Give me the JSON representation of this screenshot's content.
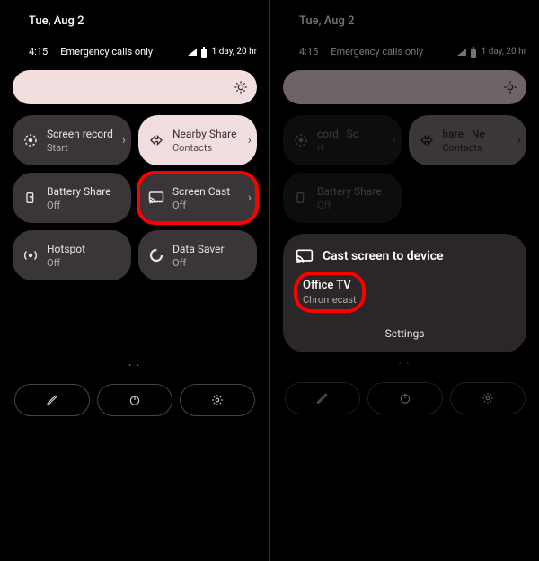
{
  "date": "Tue, Aug 2",
  "status": {
    "time": "4:15",
    "emergency": "Emergency calls only",
    "battery": "1 day, 20 hr"
  },
  "left_tiles": {
    "screen_record": {
      "title": "Screen record",
      "sub": "Start"
    },
    "nearby_share": {
      "title": "Nearby Share",
      "sub": "Contacts"
    },
    "battery_share": {
      "title": "Battery Share",
      "sub": "Off"
    },
    "screen_cast": {
      "title": "Screen Cast",
      "sub": "Off"
    },
    "hotspot": {
      "title": "Hotspot",
      "sub": "Off"
    },
    "data_saver": {
      "title": "Data Saver",
      "sub": "Off"
    }
  },
  "right_tiles": {
    "t1": {
      "title_a": "cord",
      "title_b": "Sc",
      "sub": "rt"
    },
    "t2": {
      "title_a": "hare",
      "title_b": "Ne",
      "sub": "Contacts"
    },
    "battery_share": {
      "title": "Battery Share",
      "sub": "Off"
    }
  },
  "cast_panel": {
    "title": "Cast screen to device",
    "device_name": "Office TV",
    "device_sub": "Chromecast",
    "settings": "Settings"
  }
}
